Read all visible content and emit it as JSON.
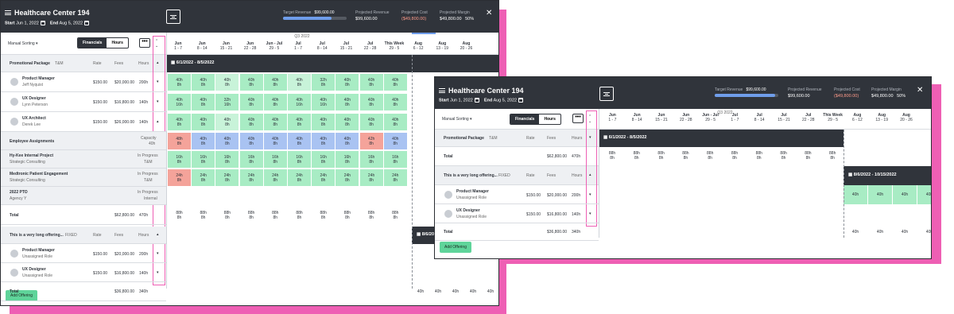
{
  "app": {
    "title": "Healthcare Center 194",
    "start_label": "Start",
    "start_date": "Jun 1, 2022",
    "end_label": "End",
    "end_date": "Aug 5, 2022"
  },
  "metrics": {
    "target_revenue_label": "Target Revenue",
    "target_revenue": "$99,600.00",
    "target_revenue_progress": 0.95,
    "projected_revenue_label": "Projected Revenue",
    "projected_revenue": "$99,600.00",
    "projected_cost_label": "Projected Cost",
    "projected_cost": "($49,800.00)",
    "projected_margin_label": "Projected Margin",
    "projected_margin": "$49,800.00",
    "projected_margin_pct": "50%"
  },
  "toolbar": {
    "sorting": "Manual Sorting",
    "financials": "Financials",
    "hours": "Hours",
    "more": "•••"
  },
  "quarter": "Q3",
  "quarter_year": "2022",
  "weeks": [
    {
      "m": "Jun",
      "d": "1 - 7"
    },
    {
      "m": "Jun",
      "d": "8 - 14"
    },
    {
      "m": "Jun",
      "d": "15 - 21"
    },
    {
      "m": "Jun",
      "d": "22 - 28"
    },
    {
      "m": "Jun - Jul",
      "d": "29 - 5"
    },
    {
      "m": "Jul",
      "d": "1 - 7"
    },
    {
      "m": "Jul",
      "d": "8 - 14"
    },
    {
      "m": "Jul",
      "d": "15 - 21"
    },
    {
      "m": "Jul",
      "d": "22 - 28"
    },
    {
      "m": "This Week",
      "d": "29 - 5"
    },
    {
      "m": "Aug",
      "d": "6 - 12"
    },
    {
      "m": "Aug",
      "d": "13 - 19"
    },
    {
      "m": "Aug",
      "d": "20 - 26"
    }
  ],
  "cols": {
    "rate": "Rate",
    "fees": "Fees",
    "hours": "Hours"
  },
  "left_panel": {
    "offering1": {
      "name": "Promotional Package",
      "type": "T&M",
      "range": "6/1/2022 - 8/5/2022"
    },
    "roles": [
      {
        "title": "Product Manager",
        "person": "Jeff Nyquist",
        "rate": "$150.00",
        "fees": "$20,000.00",
        "hours": "200h",
        "cells": [
          "40h 8h",
          "40h 8h",
          "40h 8h",
          "40h 8h",
          "40h 8h",
          "40h 8h",
          "32h 8h",
          "40h 8h",
          "40h 8h",
          "40h 8h"
        ]
      },
      {
        "title": "UX Designer",
        "person": "Lynn Peterson",
        "rate": "$150.00",
        "fees": "$16,800.00",
        "hours": "140h",
        "cells": [
          "40h 16h",
          "40h 8h",
          "32h 16h",
          "40h 8h",
          "40h 8h",
          "40h 16h",
          "40h 16h",
          "40h 8h",
          "40h 8h",
          "40h 8h"
        ]
      },
      {
        "title": "UX Architect",
        "person": "Derek Lee",
        "rate": "$150.00",
        "fees": "$26,000.00",
        "hours": "140h",
        "cells": [
          "40h 8h",
          "40h 8h",
          "40h 8h",
          "40h 8h",
          "40h 8h",
          "40h 8h",
          "40h 8h",
          "40h 8h",
          "40h 8h",
          "40h 8h"
        ]
      }
    ],
    "assignments_label": "Employee Assignments",
    "capacity_label": "Capacity",
    "capacity_value": "40h",
    "capacity_cells": [
      "48h 8h",
      "40h 8h",
      "40h 8h",
      "40h 8h",
      "40h 8h",
      "40h 8h",
      "40h 8h",
      "40h 8h",
      "42h 8h",
      "40h 8h"
    ],
    "assignments": [
      {
        "name": "Hy-Kee Internal Project",
        "sub": "Strategic Consulting",
        "status": "In Progress",
        "type": "T&M",
        "cells": [
          "16h 8h",
          "16h 8h",
          "16h 8h",
          "16h 8h",
          "16h 8h",
          "16h 8h",
          "16h 8h",
          "16h 8h",
          "16h 8h",
          "16h 8h"
        ]
      },
      {
        "name": "Medtronic Patient Engagement",
        "sub": "Strategic Consulting",
        "status": "In Progress",
        "type": "T&M",
        "cells": [
          "24h 8h",
          "24h 8h",
          "24h 8h",
          "24h 8h",
          "24h 8h",
          "24h 8h",
          "24h 8h",
          "24h 8h",
          "24h 8h",
          "24h 8h"
        ]
      },
      {
        "name": "2022 PTO",
        "sub": "Agency Y",
        "status": "In Progress",
        "type": "Internal",
        "cells": []
      }
    ],
    "total_label": "Total",
    "total1": {
      "fees": "$62,800.00",
      "hours": "470h",
      "cells": [
        "88h 8h",
        "88h 8h",
        "88h 8h",
        "88h 8h",
        "88h 8h",
        "88h 8h",
        "88h 8h",
        "88h 8h",
        "88h 8h",
        "88h 8h"
      ]
    },
    "offering2": {
      "name": "This is a very long offering...",
      "type": "FIXED",
      "range": "8/6/2022 - 10/15/2022"
    },
    "roles2": [
      {
        "title": "Product Manager",
        "person": "Unassigned Role",
        "rate": "$150.00",
        "fees": "$20,000.00",
        "hours": "200h"
      },
      {
        "title": "UX Designer",
        "person": "Unassigned Role",
        "rate": "$150.00",
        "fees": "$16,800.00",
        "hours": "140h"
      }
    ],
    "total2": {
      "fees": "$36,800.00",
      "hours": "340h",
      "cells": [
        "40h",
        "40h",
        "40h",
        "40h",
        "40h"
      ]
    },
    "add_offering": "Add Offering"
  },
  "right_panel": {
    "offering1_range": "6/1/2022 - 8/5/2022",
    "total1": {
      "fees": "$62,800.00",
      "hours": "470h"
    },
    "total1_cells": [
      "88h 8h",
      "88h 8h",
      "88h 8h",
      "88h 8h",
      "88h 8h",
      "88h 8h",
      "88h 8h",
      "88h 8h",
      "88h 8h",
      "88h 8h"
    ],
    "offering2_range": "8/6/2022 - 10/15/2022",
    "role_cells": [
      "40h",
      "40h",
      "40h",
      "40h"
    ],
    "total2_cells": [
      "40h",
      "40h",
      "40h",
      "40h"
    ]
  }
}
